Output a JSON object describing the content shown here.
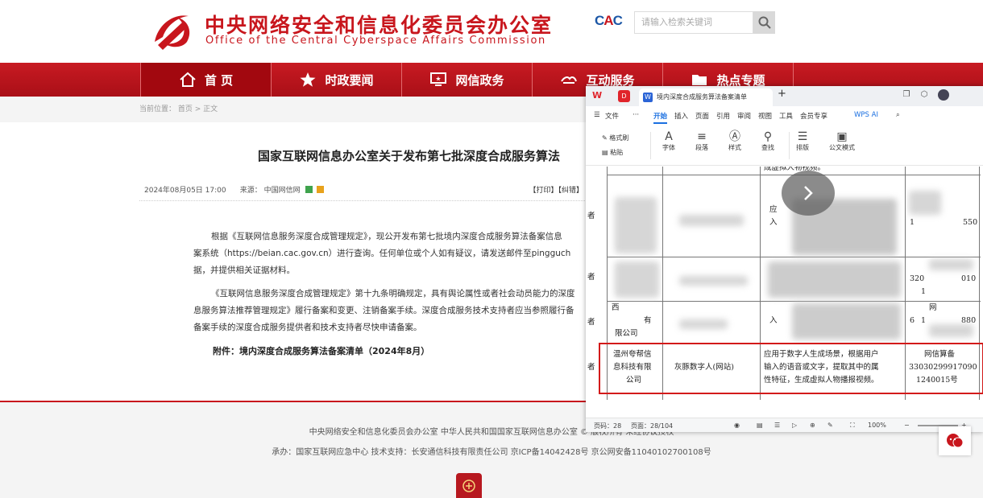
{
  "site": {
    "title_cn": "中央网络安全和信息化委员会办公室",
    "title_en": "Office of the Central Cyberspace Affairs Commission",
    "logo_text": "CAC",
    "search_placeholder": "请输入检索关键词"
  },
  "nav": [
    {
      "label": "首 页",
      "icon": "home-icon"
    },
    {
      "label": "时政要闻",
      "icon": "star-icon"
    },
    {
      "label": "网信政务",
      "icon": "monitor-icon"
    },
    {
      "label": "互动服务",
      "icon": "handshake-icon"
    },
    {
      "label": "热点专题",
      "icon": "folder-icon"
    }
  ],
  "breadcrumb": "当前位置： 首页 > 正文",
  "article": {
    "title": "国家互联网信息办公室关于发布第七批深度合成服务算法",
    "date": "2024年08月05日 17:00",
    "source_label": "来源：",
    "source": "中国网信网",
    "tools": "【打印】【纠错】",
    "paragraphs": [
      "根据《互联网信息服务深度合成管理规定》，现公开发布第七批境内深度合成服务算法备案信息",
      "案系统（https://beian.cac.gov.cn）进行查询。任何单位或个人如有疑议，请发送邮件至pingguch",
      "据，并提供相关证据材料。",
      "《互联网信息服务深度合成管理规定》第十九条明确规定，具有舆论属性或者社会动员能力的深度",
      "息服务算法推荐管理规定》履行备案和变更、注销备案手续。深度合成服务技术支持者应当参照履行备",
      "备案手续的深度合成服务提供者和技术支持者尽快申请备案。"
    ],
    "attachment": "附件：境内深度合成服务算法备案清单（2024年8月）"
  },
  "footer": {
    "line1": "中央网络安全和信息化委员会办公室    中华人民共和国国家互联网信息办公室 © 版权所有 未经协议授权",
    "line2": "承办：国家互联网应急中心    技术支持：长安通信科技有限责任公司    京ICP备14042428号    京公网安备11040102700108号"
  },
  "wps": {
    "doc_tab_title": "境内深度合成服务算法备案清单",
    "menus": [
      "文件",
      "开始",
      "插入",
      "页面",
      "引用",
      "审阅",
      "视图",
      "工具",
      "会员专享",
      "WPS AI"
    ],
    "active_menu": "开始",
    "ribbon": [
      {
        "label": "格式刷",
        "icon": "brush-icon"
      },
      {
        "label": "粘贴",
        "icon": "paste-icon"
      },
      {
        "label": "字体",
        "icon": "font-icon"
      },
      {
        "label": "段落",
        "icon": "paragraph-icon"
      },
      {
        "label": "样式",
        "icon": "style-icon"
      },
      {
        "label": "查找",
        "icon": "search-icon"
      },
      {
        "label": "排版",
        "icon": "layout-icon"
      },
      {
        "label": "公文模式",
        "icon": "doc-mode-icon"
      }
    ],
    "table_top_fragment": "成虚拟人物视频。",
    "highlighted_row": {
      "col0": "者",
      "company": [
        "温州夸帮信",
        "息科技有限",
        "公司"
      ],
      "product": "灰豚数字人(网站)",
      "description": [
        "应用于数字人生成场景，根据用户",
        "输入的语音或文字，提取其中的属",
        "性特征，生成虚拟人物播报视频。"
      ],
      "filing_no": [
        "网信算备",
        "33030299917090",
        "1240015号"
      ]
    },
    "row_fragments": {
      "r1_col0": "者",
      "r1_desc": [
        "应",
        "入"
      ],
      "r1_num": [
        "1",
        "550"
      ],
      "r2_col0": "者",
      "r2_num": [
        "320",
        "010",
        "1"
      ],
      "r3_col0": "者",
      "r3_comp": [
        "西",
        "有",
        "限公司"
      ],
      "r3_desc": "入",
      "r3_num": [
        "网",
        "6",
        "1",
        "880"
      ]
    },
    "status": {
      "page": "页码：28",
      "pages": "页面：28/104",
      "zoom": "100%"
    }
  }
}
